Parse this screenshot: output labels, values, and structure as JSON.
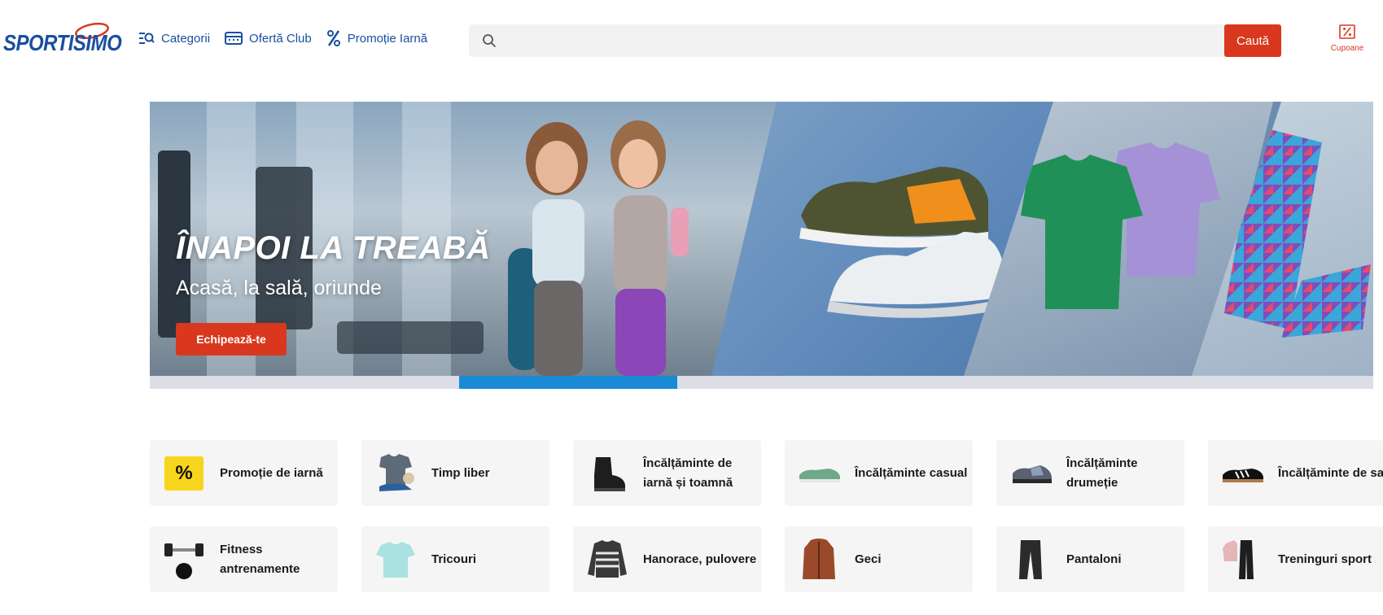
{
  "header": {
    "logo_text": "SPORTISIMO",
    "nav": [
      {
        "label": "Categorii",
        "icon": "categories-search-icon"
      },
      {
        "label": "Ofertă Club",
        "icon": "club-card-icon"
      },
      {
        "label": "Promoție Iarnă",
        "icon": "percent-icon"
      }
    ],
    "search": {
      "placeholder": "",
      "value": "",
      "button_label": "Caută"
    },
    "coupons_label": "Cupoane"
  },
  "banner": {
    "title": "ÎNAPOI LA TREABĂ",
    "subtitle": "Acasă, la sală, oriunde",
    "cta_label": "Echipează-te",
    "progress": {
      "slides": 6,
      "active_index": 1
    }
  },
  "categories": [
    {
      "label": "Promoție de iarnă",
      "thumb": "percent-badge"
    },
    {
      "label": "Timp liber",
      "thumb": "tshirt-sneaker-image"
    },
    {
      "label": "Încălțăminte de iarnă și toamnă",
      "thumb": "winter-boot-image"
    },
    {
      "label": "Încălțăminte casual",
      "thumb": "casual-shoe-image"
    },
    {
      "label": "Încălțăminte drumeție",
      "thumb": "hiking-shoe-image"
    },
    {
      "label": "Încălțăminte de sală",
      "thumb": "indoor-shoe-image"
    },
    {
      "label": "Fitness antrenamente",
      "thumb": "dumbbell-image"
    },
    {
      "label": "Tricouri",
      "thumb": "tshirt-image"
    },
    {
      "label": "Hanorace, pulovere",
      "thumb": "sweater-image"
    },
    {
      "label": "Geci",
      "thumb": "jacket-image"
    },
    {
      "label": "Pantaloni",
      "thumb": "pants-image"
    },
    {
      "label": "Treninguri sport",
      "thumb": "tracksuit-image"
    }
  ],
  "colors": {
    "brand_blue": "#1a4fa0",
    "accent_red": "#d9381e",
    "progress_blue": "#1a8ad6",
    "promo_yellow": "#f7d51c"
  }
}
